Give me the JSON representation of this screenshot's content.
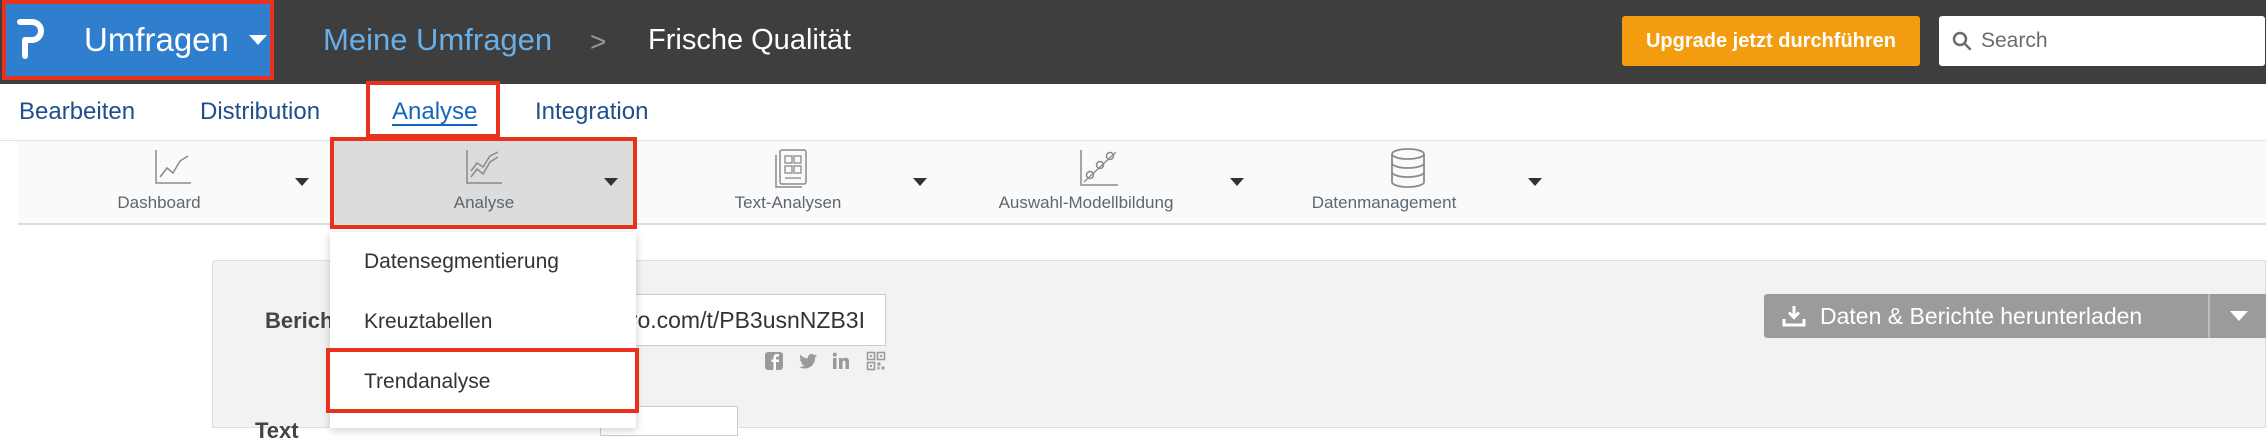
{
  "topbar": {
    "app_name": "Umfragen",
    "breadcrumb": {
      "project": "Meine Umfragen",
      "separator": ">",
      "survey": "Frische Qualität"
    },
    "upgrade_label": "Upgrade jetzt durchführen",
    "search_placeholder": "Search"
  },
  "tabs": [
    {
      "label": "Bearbeiten",
      "active": false
    },
    {
      "label": "Distribution",
      "active": false
    },
    {
      "label": "Analyse",
      "active": true
    },
    {
      "label": "Integration",
      "active": false
    }
  ],
  "toolbar": [
    {
      "label": "Dashboard",
      "icon": "line-chart-icon"
    },
    {
      "label": "Analyse",
      "icon": "analysis-chart-icon",
      "active": true
    },
    {
      "label": "Text-Analysen",
      "icon": "text-report-icon"
    },
    {
      "label": "Auswahl-Modellbildung",
      "icon": "scatter-chart-icon"
    },
    {
      "label": "Datenmanagement",
      "icon": "database-icon"
    }
  ],
  "analyse_menu": {
    "items": [
      "Datensegmentierung",
      "Kreuztabellen",
      "Trendanalyse"
    ],
    "highlighted": "Trendanalyse"
  },
  "report": {
    "label": "Bericht",
    "url_visible": "pro.com/t/PB3usnNZB3I",
    "download_label": "Daten & Berichte herunterladen",
    "cut_label": "Text"
  },
  "colors": {
    "topbar": "#3e3e3e",
    "brand": "#2f7fce",
    "upgrade": "#f39c0f",
    "highlight": "#e8321e",
    "tab_text": "#1e4f8a"
  }
}
